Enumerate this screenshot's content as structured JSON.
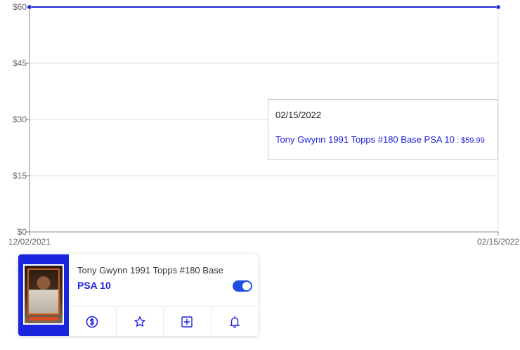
{
  "chart_data": {
    "type": "line",
    "x": [
      "12/02/2021",
      "02/15/2022"
    ],
    "series": [
      {
        "values": [
          59.99,
          59.99
        ],
        "color": "#1f22d6"
      }
    ],
    "ylim": [
      0,
      60
    ],
    "yticks": [
      "$0",
      "$15",
      "$30",
      "$45",
      "$60"
    ],
    "xticks": [
      "12/02/2021",
      "02/15/2022"
    ],
    "grid": true
  },
  "tooltip": {
    "date": "02/15/2022",
    "series_label": "Tony Gwynn 1991 Topps #180 Base PSA 10",
    "separator": " : ",
    "value": "$59.99"
  },
  "card": {
    "name": "Tony Gwynn 1991 Topps #180 Base",
    "grade": "PSA 10",
    "toggle_on": true,
    "accent_color": "#1a25e0",
    "actions": [
      "dollar-circle-icon",
      "star-icon",
      "plus-square-icon",
      "bell-icon"
    ]
  }
}
